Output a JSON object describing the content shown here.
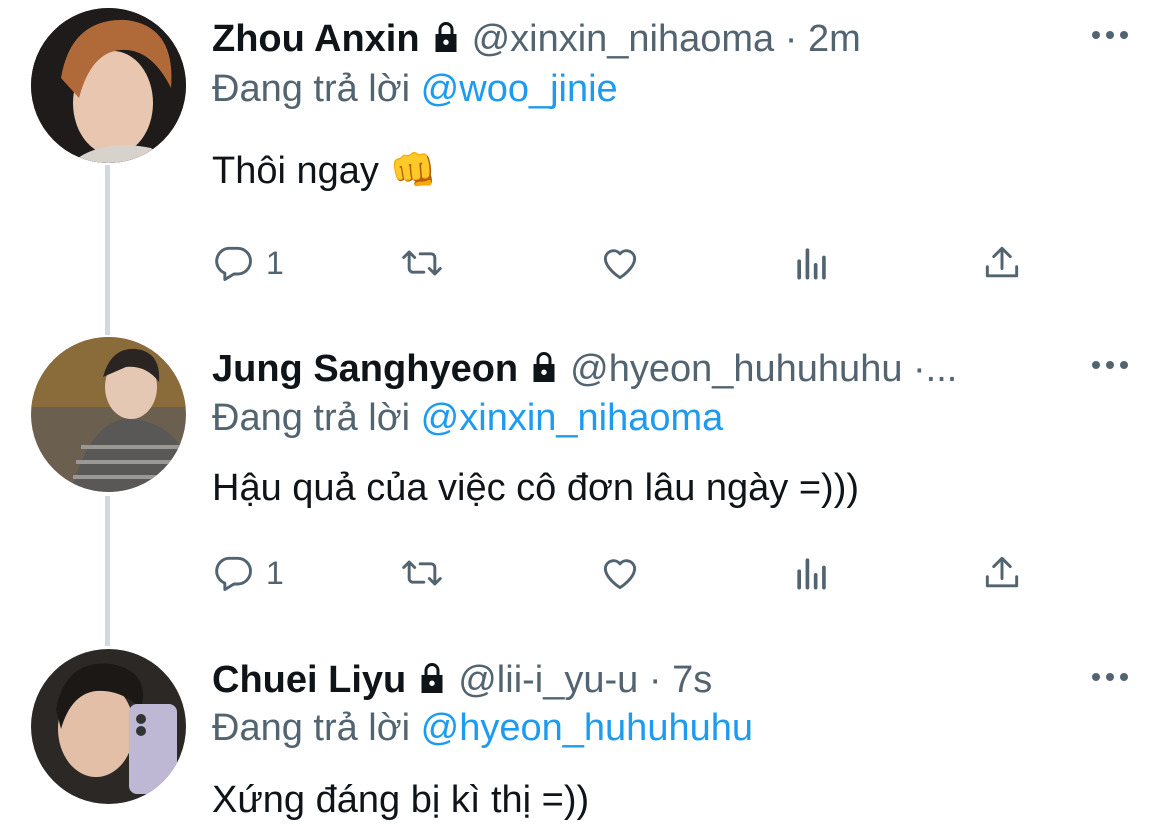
{
  "tweets": [
    {
      "name": "Zhou Anxin",
      "handle": "@xinxin_nihaoma",
      "separator": "·",
      "time": "2m",
      "replying_prefix": "Đang trả lời",
      "replying_to": "@woo_jinie",
      "text": "Thôi ngay",
      "emoji": "👊",
      "reply_count": "1"
    },
    {
      "name": "Jung Sanghyeon",
      "handle": "@hyeon_huhuhuhu",
      "separator": "·...",
      "time": "",
      "replying_prefix": "Đang trả lời",
      "replying_to": "@xinxin_nihaoma",
      "text": "Hậu quả của việc cô đơn lâu ngày =)))",
      "reply_count": "1"
    },
    {
      "name": "Chuei Liyu",
      "handle": "@lii-i_yu-u",
      "separator": "·",
      "time": "7s",
      "replying_prefix": "Đang trả lời",
      "replying_to": "@hyeon_huhuhuhu",
      "text": "Xứng đáng bị kì thị =))"
    }
  ],
  "colors": {
    "link": "#1d9bf0",
    "muted": "#536471",
    "thread_line": "#cfd9de"
  },
  "icons": [
    "lock-icon",
    "more-icon",
    "reply-icon",
    "retweet-icon",
    "like-icon",
    "analytics-icon",
    "share-icon"
  ]
}
